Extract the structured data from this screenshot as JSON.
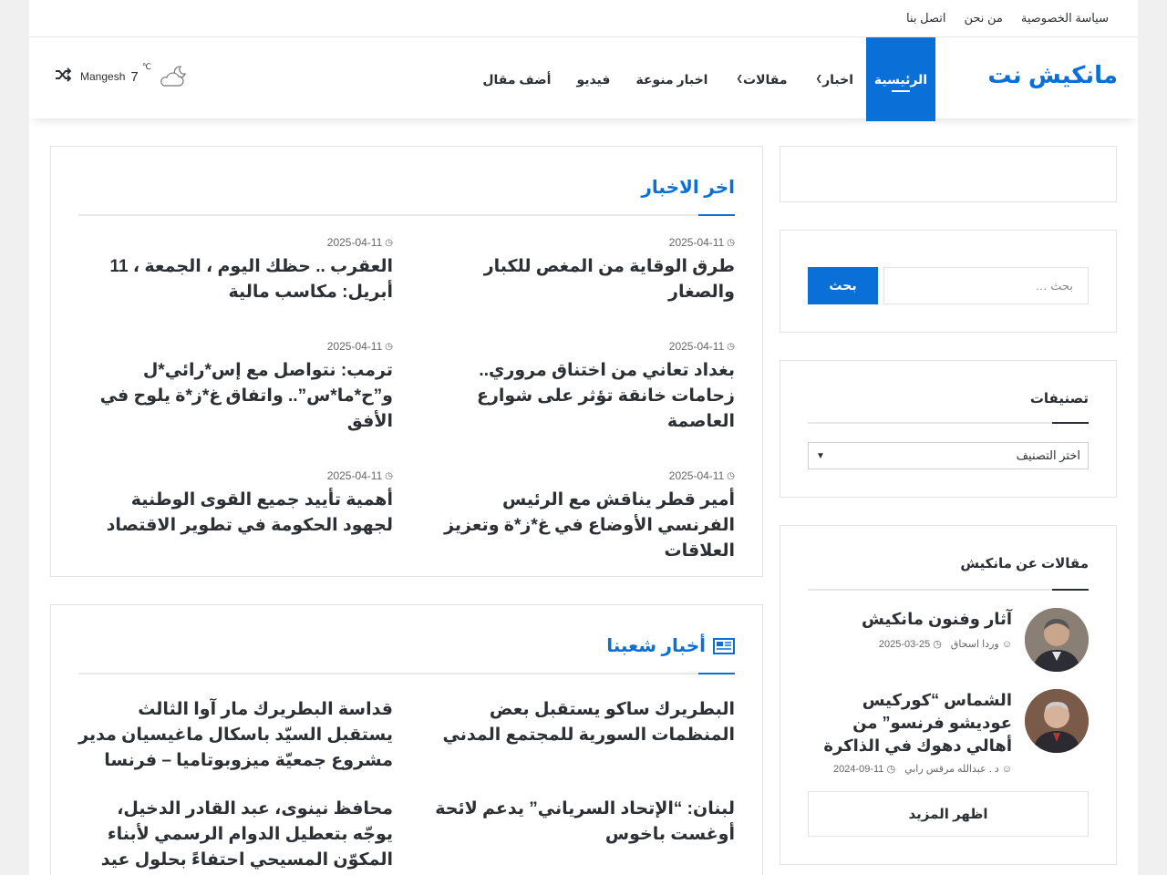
{
  "topnav": {
    "items": [
      "سياسة الخصوصية",
      "من نحن",
      "اتصل بنا"
    ]
  },
  "header": {
    "logo": "مانكيش نت",
    "nav": [
      {
        "label": "الرئيسية",
        "active": true,
        "dropdown": false
      },
      {
        "label": "اخبار",
        "active": false,
        "dropdown": true
      },
      {
        "label": "مقالات",
        "active": false,
        "dropdown": true
      },
      {
        "label": "اخبار منوعة",
        "active": false,
        "dropdown": false
      },
      {
        "label": "فيديو",
        "active": false,
        "dropdown": false
      },
      {
        "label": "أضف مقال",
        "active": false,
        "dropdown": false
      }
    ],
    "weather": {
      "temp": "7",
      "unit": "℃",
      "city": "Mangesh",
      "icon": "cloud-moon-icon"
    },
    "shuffle_icon": "shuffle-icon"
  },
  "latest": {
    "title": "اخر الاخبار",
    "posts": [
      {
        "date": "2025-04-11",
        "title": "طرق الوقاية من المغص للكبار والصغار"
      },
      {
        "date": "2025-04-11",
        "title": "العقرب .. حظك اليوم ، الجمعة ، 11 أبريل: مكاسب مالية"
      },
      {
        "date": "2025-04-11",
        "title": "بغداد تعاني من اختناق مروري.. زحامات خانقة تؤثر على شوارع العاصمة"
      },
      {
        "date": "2025-04-11",
        "title": "ترمب: نتواصل مع إس*رائي*ل و”ح*ما*س”.. واتفاق غ*ز*ة يلوح في الأفق"
      },
      {
        "date": "2025-04-11",
        "title": "أمير قطر يناقش مع الرئيس الفرنسي الأوضاع في غ*ز*ة وتعزيز العلاقات"
      },
      {
        "date": "2025-04-11",
        "title": "أهمية تأييد جميع القوى الوطنية لجهود الحكومة في تطوير الاقتصاد"
      }
    ]
  },
  "people": {
    "title": "أخبار شعبنا",
    "posts": [
      {
        "title": "البطريرك ساكو يستقبل بعض  المنظمات السورية للمجتمع المدني"
      },
      {
        "title": "قداسة البطريرك مار آوا الثالث يستقبل السيّد باسكال ماغيسيان مدير مشروع جمعيّة ميزوبوتاميا – فرنسا"
      },
      {
        "title": "لبنان: “الإتحاد السرياني” يدعم لائحة أوغست باخوس"
      },
      {
        "title": "محافظ نينوى، عبد القادر الدخيل، يوجّه بتعطيل الدوام الرسمي لأبناء المكوّن المسيحي احتفاءً بحلول عيد السعانين"
      }
    ]
  },
  "sidebar": {
    "search": {
      "placeholder": "بحث …",
      "button": "بحث"
    },
    "categories": {
      "title": "تصنيفات",
      "selected": "اختر التصنيف"
    },
    "articles": {
      "title": "مقالات عن مانكيش",
      "items": [
        {
          "title": "آثار وفنون مانكيش",
          "author": "وردا اسحاق",
          "date": "2025-03-25"
        },
        {
          "title": "الشماس “كوركيس عوديشو فرنسو” من أهالي دهوك في الذاكرة",
          "author": "د . عبدالله مرقس رابي",
          "date": "2024-09-11"
        }
      ],
      "more": "اظهر المزيد"
    }
  },
  "colors": {
    "accent": "#0a6fd7",
    "text": "#2c2f34"
  }
}
